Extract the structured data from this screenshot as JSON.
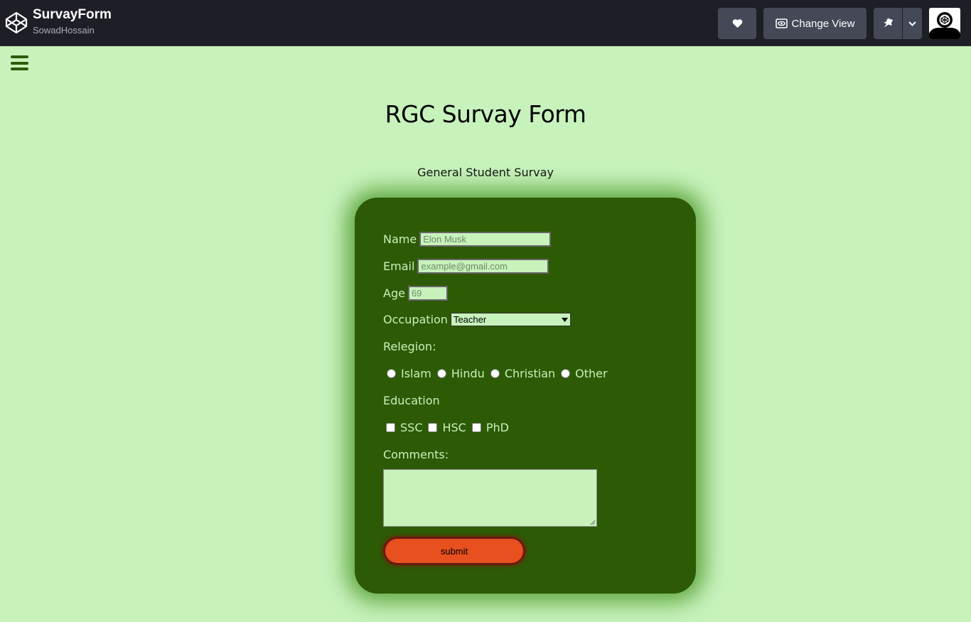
{
  "header": {
    "pen_title": "SurvayForm",
    "author": "SowadHossain",
    "change_view_label": "Change View",
    "icons": [
      "codepen-logo-icon",
      "heart-icon",
      "eye-icon",
      "pin-icon",
      "chevron-down-icon",
      "avatar"
    ]
  },
  "page": {
    "title": "RGC Survay Form",
    "subtitle": "General Student Survay"
  },
  "form": {
    "name_label": "Name",
    "name_placeholder": "Elon Musk",
    "email_label": "Email",
    "email_placeholder": "example@gmail.com",
    "age_label": "Age",
    "age_placeholder": "69",
    "occupation_label": "Occupation",
    "occupation_selected": "Teacher",
    "religion_label": "Relegion:",
    "religion_options": [
      "Islam",
      "Hindu",
      "Christian",
      "Other"
    ],
    "education_label": "Education",
    "education_options": [
      "SSC",
      "HSC",
      "PhD"
    ],
    "comments_label": "Comments:",
    "submit_label": "submit"
  },
  "colors": {
    "page_bg": "#c7f2bc",
    "card_bg": "#2d5a05",
    "topbar_bg": "#1e1f26",
    "submit_bg": "#e8501f"
  }
}
